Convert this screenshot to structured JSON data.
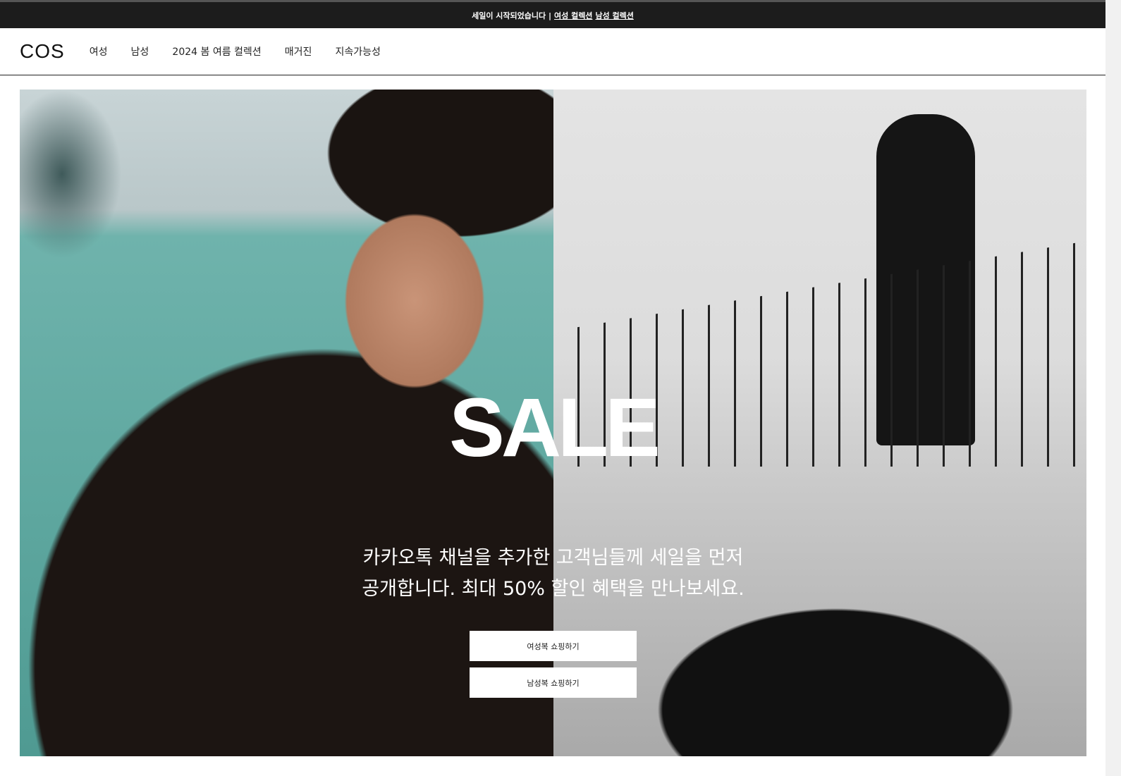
{
  "announcement": {
    "text": "세일이 시작되었습니다 |",
    "women_link": "여성 컬렉션",
    "men_link": "남성 컬렉션"
  },
  "header": {
    "logo": "COS",
    "nav": [
      "여성",
      "남성",
      "2024 봄 여름 컬렉션",
      "매거진",
      "지속가능성"
    ]
  },
  "hero": {
    "title": "SALE",
    "subtitle_line1": "카카오톡 채널을 추가한 고객님들께 세일을 먼저",
    "subtitle_line2": "공개합니다. 최대 50% 할인 혜택을 만나보세요.",
    "women_button": "여성복 쇼핑하기",
    "men_button": "남성복 쇼핑하기"
  }
}
